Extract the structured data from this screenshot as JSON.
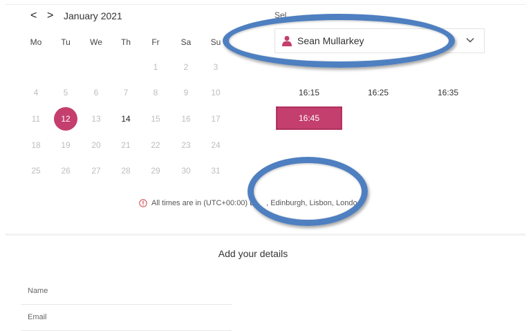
{
  "calendar": {
    "month_label": "January 2021",
    "prev_label": "<",
    "next_label": ">",
    "weekdays": [
      "Mo",
      "Tu",
      "We",
      "Th",
      "Fr",
      "Sa",
      "Su"
    ],
    "weeks": [
      [
        null,
        null,
        null,
        null,
        "1",
        "2",
        "3"
      ],
      [
        "4",
        "5",
        "6",
        "7",
        "8",
        "9",
        "10"
      ],
      [
        "11",
        "12",
        "13",
        "14",
        "15",
        "16",
        "17"
      ],
      [
        "18",
        "19",
        "20",
        "21",
        "22",
        "23",
        "24"
      ],
      [
        "25",
        "26",
        "27",
        "28",
        "29",
        "30",
        "31"
      ]
    ],
    "selected_day": "12",
    "available_days": [
      "12",
      "14"
    ]
  },
  "staff": {
    "label": "Sel",
    "selected_name": "Sean Mullarkey"
  },
  "times": {
    "slots": [
      "16:15",
      "16:25",
      "16:35",
      "16:45"
    ],
    "selected": "16:45"
  },
  "timezone": {
    "prefix": "All times are in",
    "value_visible": "(UTC+00:00) D",
    "value_tail": ", Edinburgh, Lisbon, Londo"
  },
  "details": {
    "title": "Add your details",
    "name_placeholder": "Name",
    "email_placeholder": "Email"
  },
  "colors": {
    "accent": "#c43e6e",
    "annotation": "#4e7fc0"
  }
}
